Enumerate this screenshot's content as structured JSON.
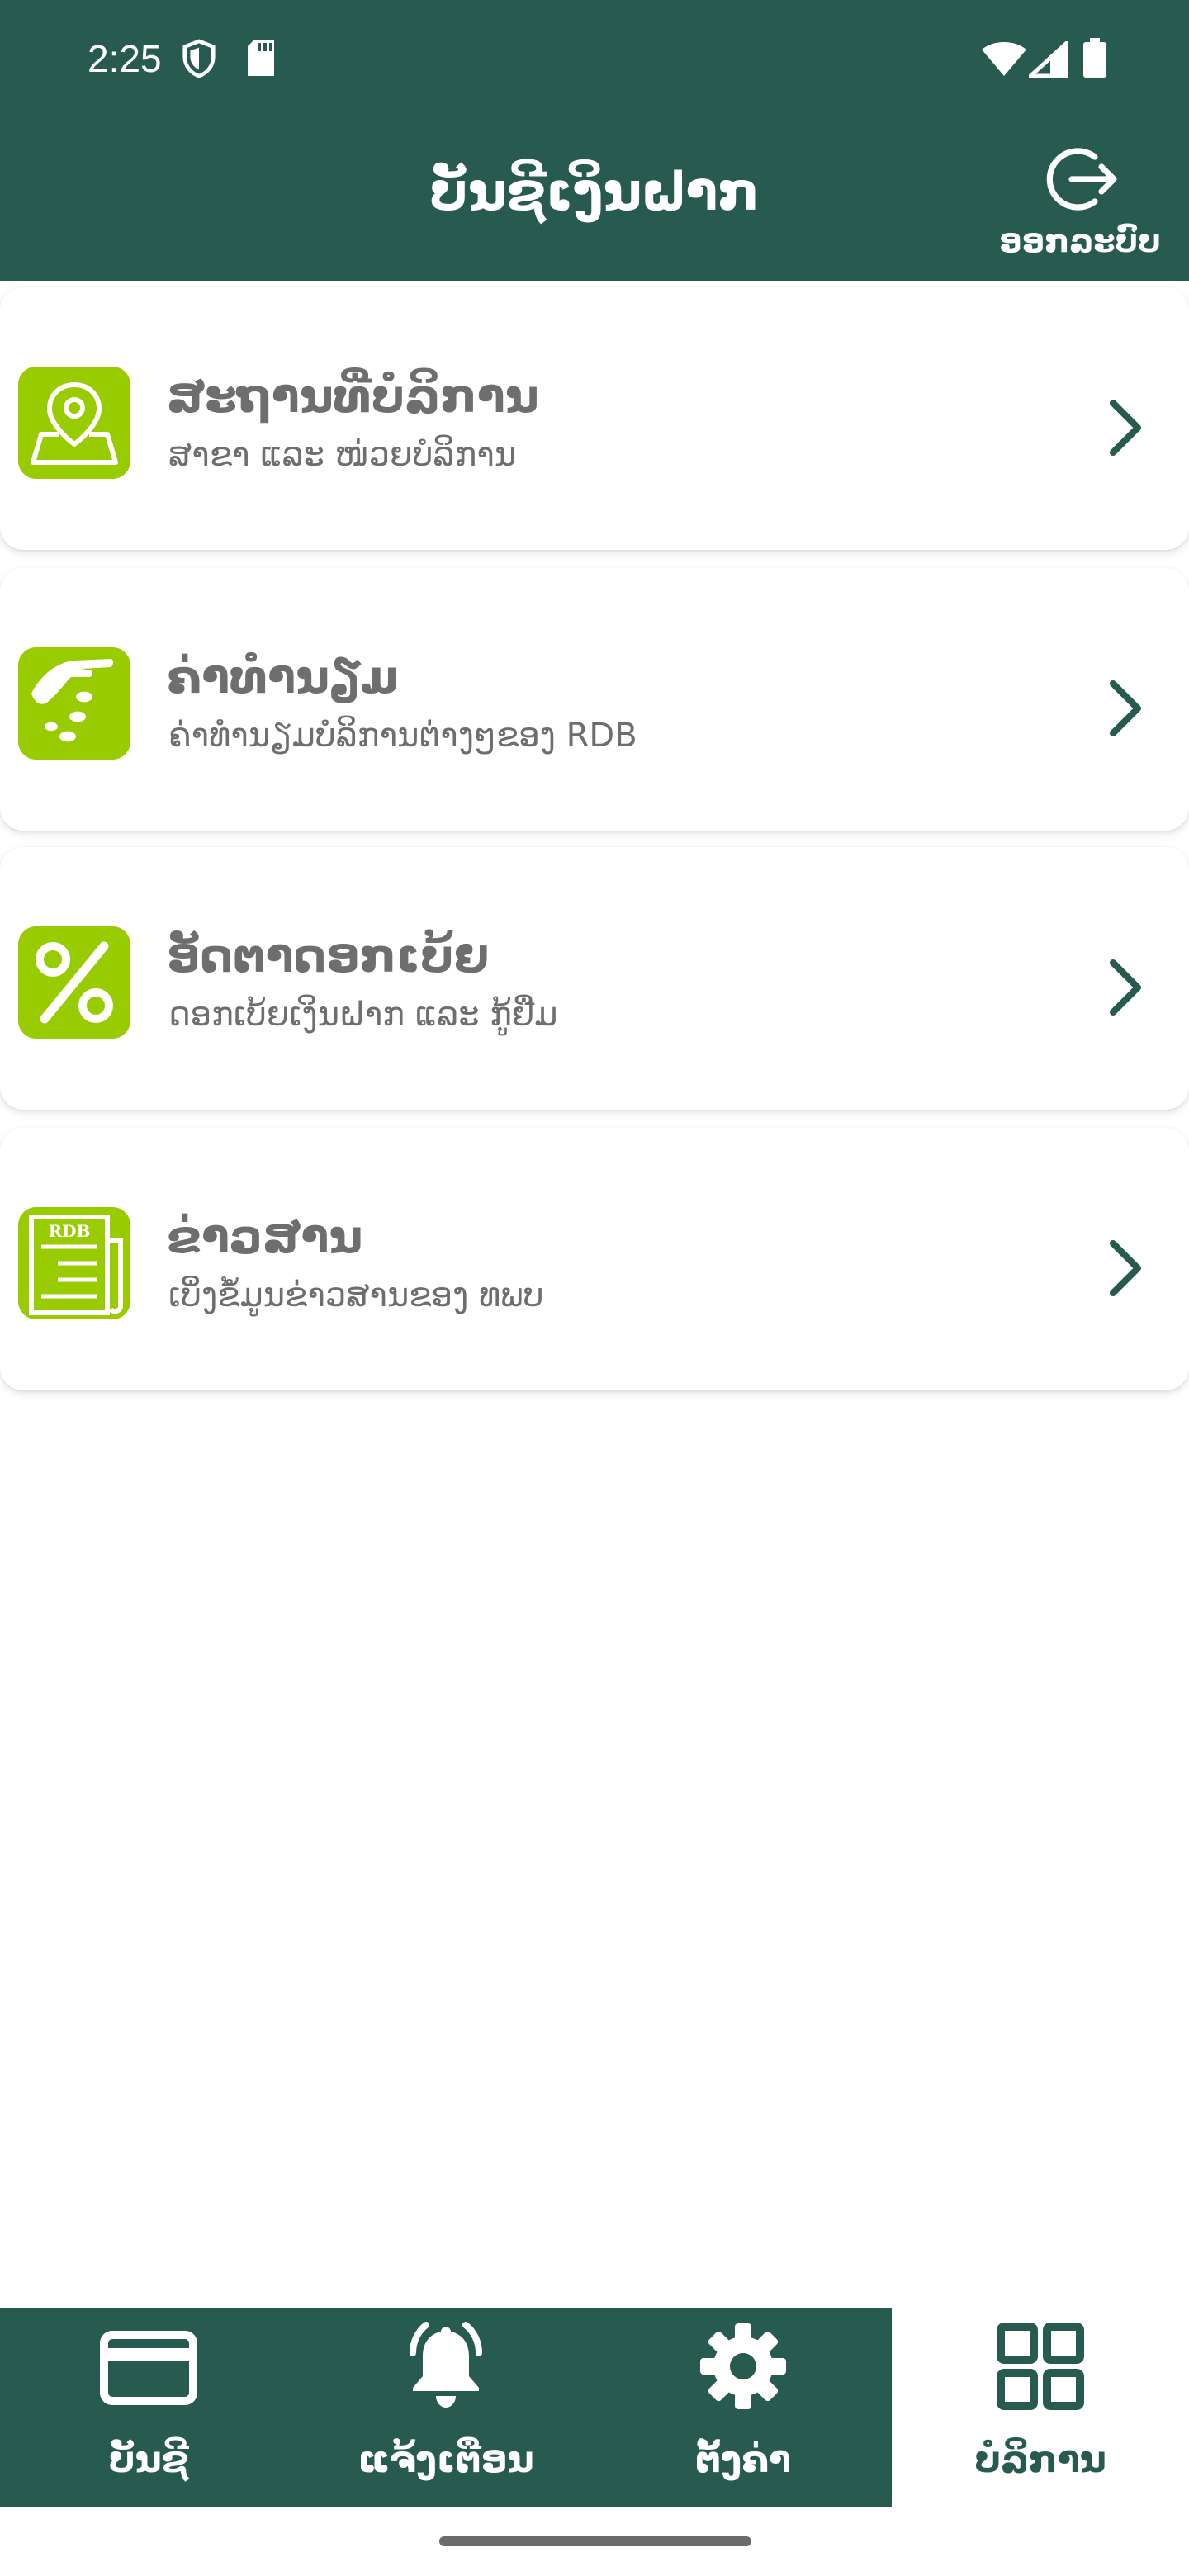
{
  "status_bar": {
    "time": "2:25",
    "icons": [
      "shield-icon",
      "sd-card-icon",
      "wifi-icon",
      "signal-icon",
      "battery-icon"
    ]
  },
  "header": {
    "title": "ບັນຊີເງິນຝາກ",
    "logout_label": "ອອກລະບົບ"
  },
  "colors": {
    "primary": "#285b50",
    "icon_green": "#99cc00",
    "text_gray": "#6e6e6e"
  },
  "menu": [
    {
      "icon": "location-pin-icon",
      "title": "ສະຖານທີ່ບໍລິການ",
      "subtitle": "ສາຂາ ແລະ ໜ່ວຍບໍລິການ"
    },
    {
      "icon": "hand-coins-icon",
      "title": "ຄ່າທຳນຽມ",
      "subtitle": "ຄ່າທຳນຽມບໍລິການຕ່າງໆຂອງ RDB"
    },
    {
      "icon": "percent-icon",
      "title": "ອັດຕາດອກເບ້ຍ",
      "subtitle": "ດອກເບ້ຍເງິນຝາກ ແລະ ກູ້ຢືມ"
    },
    {
      "icon": "newspaper-icon",
      "title": "ຂ່າວສານ",
      "subtitle": "ເບິ່ງຂໍ້ມູນຂ່າວສານຂອງ ທພບ",
      "icon_text": "RDB"
    }
  ],
  "bottom_nav": [
    {
      "icon": "credit-card-icon",
      "label": "ບັນຊີ",
      "active": false
    },
    {
      "icon": "bell-icon",
      "label": "ແຈ້ງເຕືອນ",
      "active": false
    },
    {
      "icon": "gear-icon",
      "label": "ຕັ້ງຄ່າ",
      "active": false
    },
    {
      "icon": "grid-icon",
      "label": "ບໍລິການ",
      "active": true
    }
  ]
}
